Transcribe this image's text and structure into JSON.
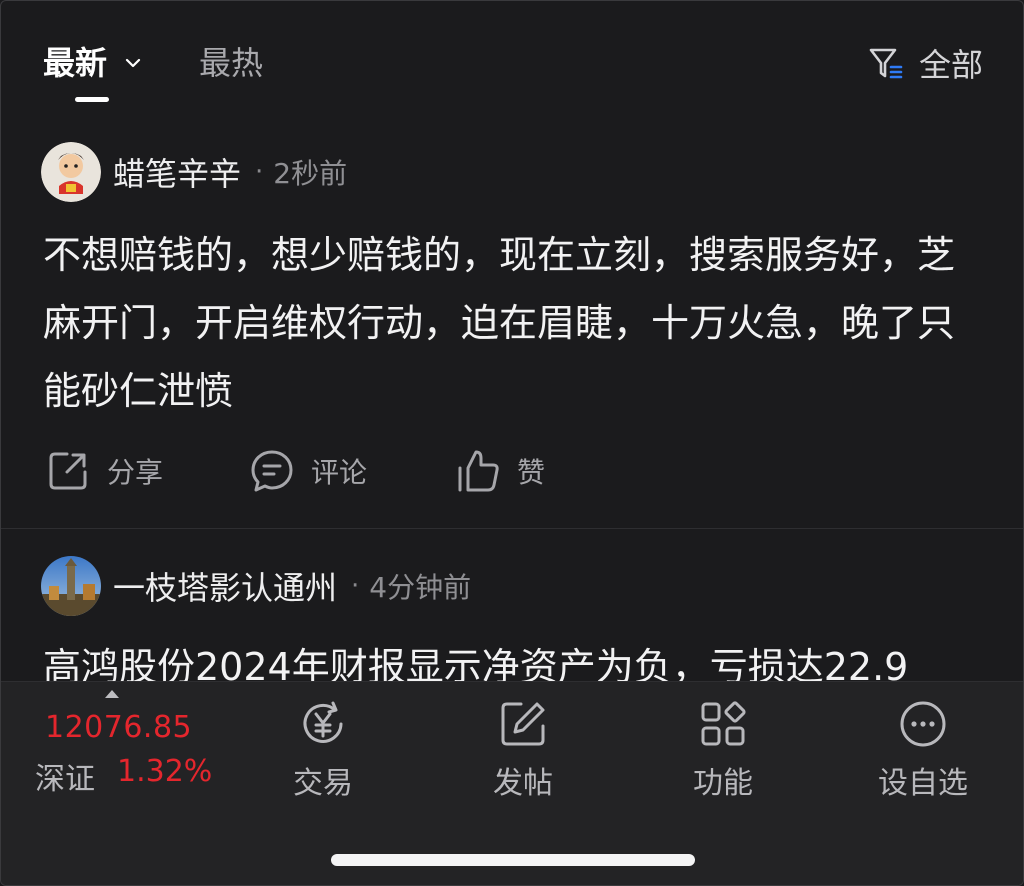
{
  "tabs": {
    "latest": "最新",
    "hot": "最热",
    "filter": "全部"
  },
  "posts": [
    {
      "username": "蜡笔辛辛",
      "separator": "·",
      "time": "2秒前",
      "content": "不想赔钱的，想少赔钱的，现在立刻，搜索服务好，芝麻开门，开启维权行动，迫在眉睫，十万火急，晚了只能砂仁泄愤",
      "actions": {
        "share": "分享",
        "comment": "评论",
        "like": "赞"
      }
    },
    {
      "username": "一枝塔影认通州",
      "separator": "·",
      "time": "4分钟前",
      "content": "高鸿股份2024年财报显示净资产为负，亏损达22.9"
    }
  ],
  "bottom_bar": {
    "index_value": "12076.85",
    "index_name": "深证",
    "index_change": "1.32%",
    "trade": "交易",
    "post": "发帖",
    "functions": "功能",
    "favorites": "设自选"
  },
  "colors": {
    "background": "#1b1b1d",
    "bar_background": "#232325",
    "up_red": "#e4262d",
    "filter_accent": "#2f7bf6"
  },
  "icons": [
    "chevron-down-icon",
    "filter-icon",
    "share-icon",
    "comment-icon",
    "thumbs-up-icon",
    "trade-yen-icon",
    "edit-icon",
    "grid-icon",
    "more-icon"
  ]
}
